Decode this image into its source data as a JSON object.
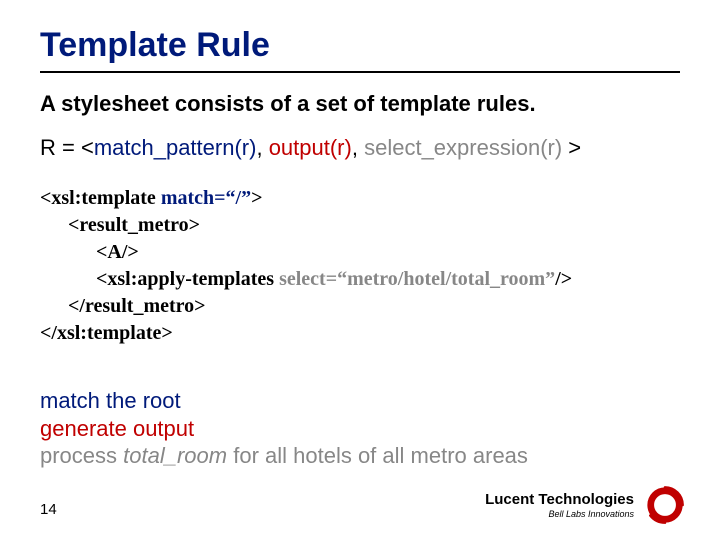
{
  "title": "Template Rule",
  "lead": "A stylesheet consists of a set of template rules.",
  "formula": {
    "prefix": "R = <",
    "p1": "match_pattern(r)",
    "c1": ",",
    "p2": "output(r)",
    "c2": ",",
    "p3": "select_expression(r)",
    "suffix": " >"
  },
  "code": {
    "l1a": "<xsl:template ",
    "l1b": "match=“/”",
    "l1c": ">",
    "l2": "<result_metro>",
    "l3": "<A/>",
    "l4a": "<xsl:apply-templates ",
    "l4b": "select=“metro/hotel/total_room”",
    "l4c": "/>",
    "l5": "</result_metro>",
    "l6": "</xsl:template>"
  },
  "explain": {
    "l1": "match the root",
    "l2": "generate output",
    "l3a": "process ",
    "l3b": "total_room",
    "l3c": " for all hotels of all metro areas"
  },
  "page": "14",
  "logo": {
    "brand": "Lucent Technologies",
    "sub": "Bell Labs Innovations"
  }
}
